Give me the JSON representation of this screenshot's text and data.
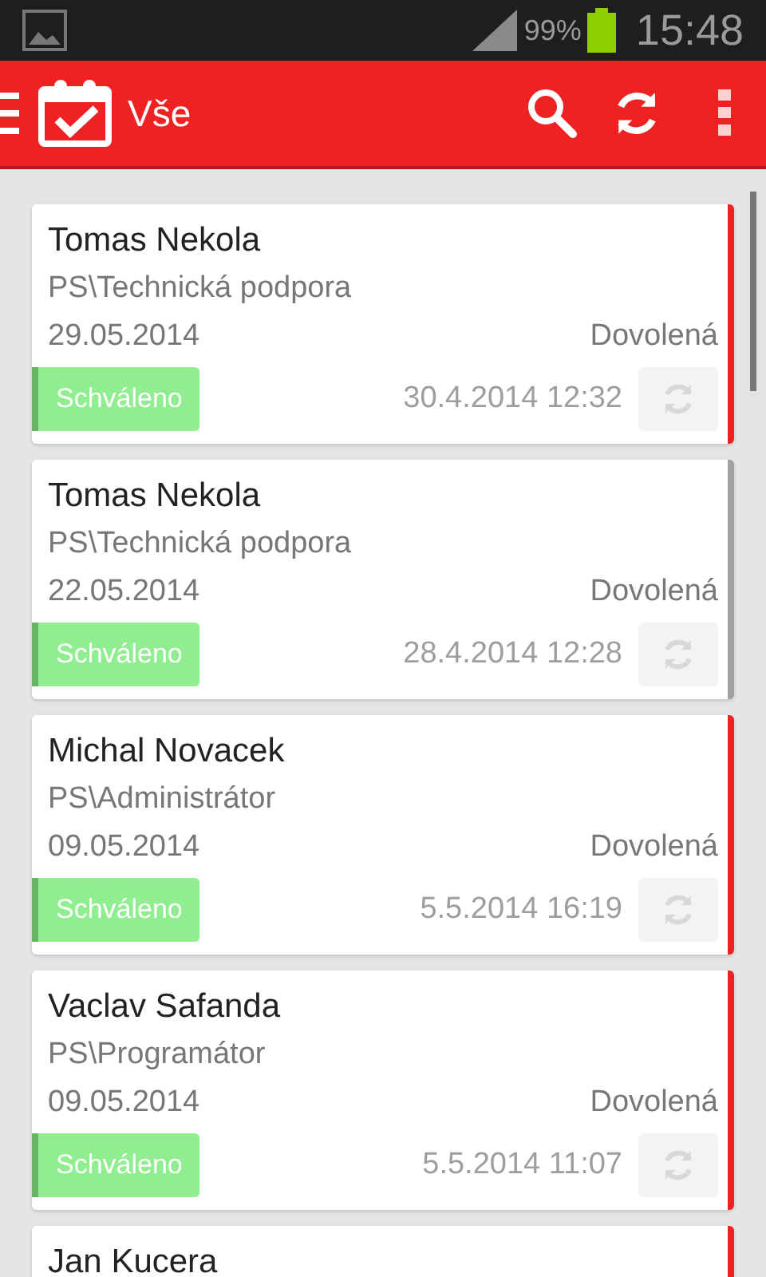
{
  "status_bar": {
    "battery": "99%",
    "time": "15:48"
  },
  "app_bar": {
    "title": "Vše"
  },
  "cards": [
    {
      "name": "Tomas Nekola",
      "department": "PS\\Technická podpora",
      "date": "29.05.2014",
      "type": "Dovolená",
      "status": "Schváleno",
      "timestamp": "30.4.2014 12:32",
      "color": "#ee2222"
    },
    {
      "name": "Tomas Nekola",
      "department": "PS\\Technická podpora",
      "date": "22.05.2014",
      "type": "Dovolená",
      "status": "Schváleno",
      "timestamp": "28.4.2014 12:28",
      "color": "#a0a0a0"
    },
    {
      "name": "Michal Novacek",
      "department": "PS\\Administrátor",
      "date": "09.05.2014",
      "type": "Dovolená",
      "status": "Schváleno",
      "timestamp": "5.5.2014 16:19",
      "color": "#ee2222"
    },
    {
      "name": "Vaclav Safanda",
      "department": "PS\\Programátor",
      "date": "09.05.2014",
      "type": "Dovolená",
      "status": "Schváleno",
      "timestamp": "5.5.2014 11:07",
      "color": "#ee2222"
    },
    {
      "name": "Jan Kucera",
      "color": "#ee2222"
    }
  ]
}
